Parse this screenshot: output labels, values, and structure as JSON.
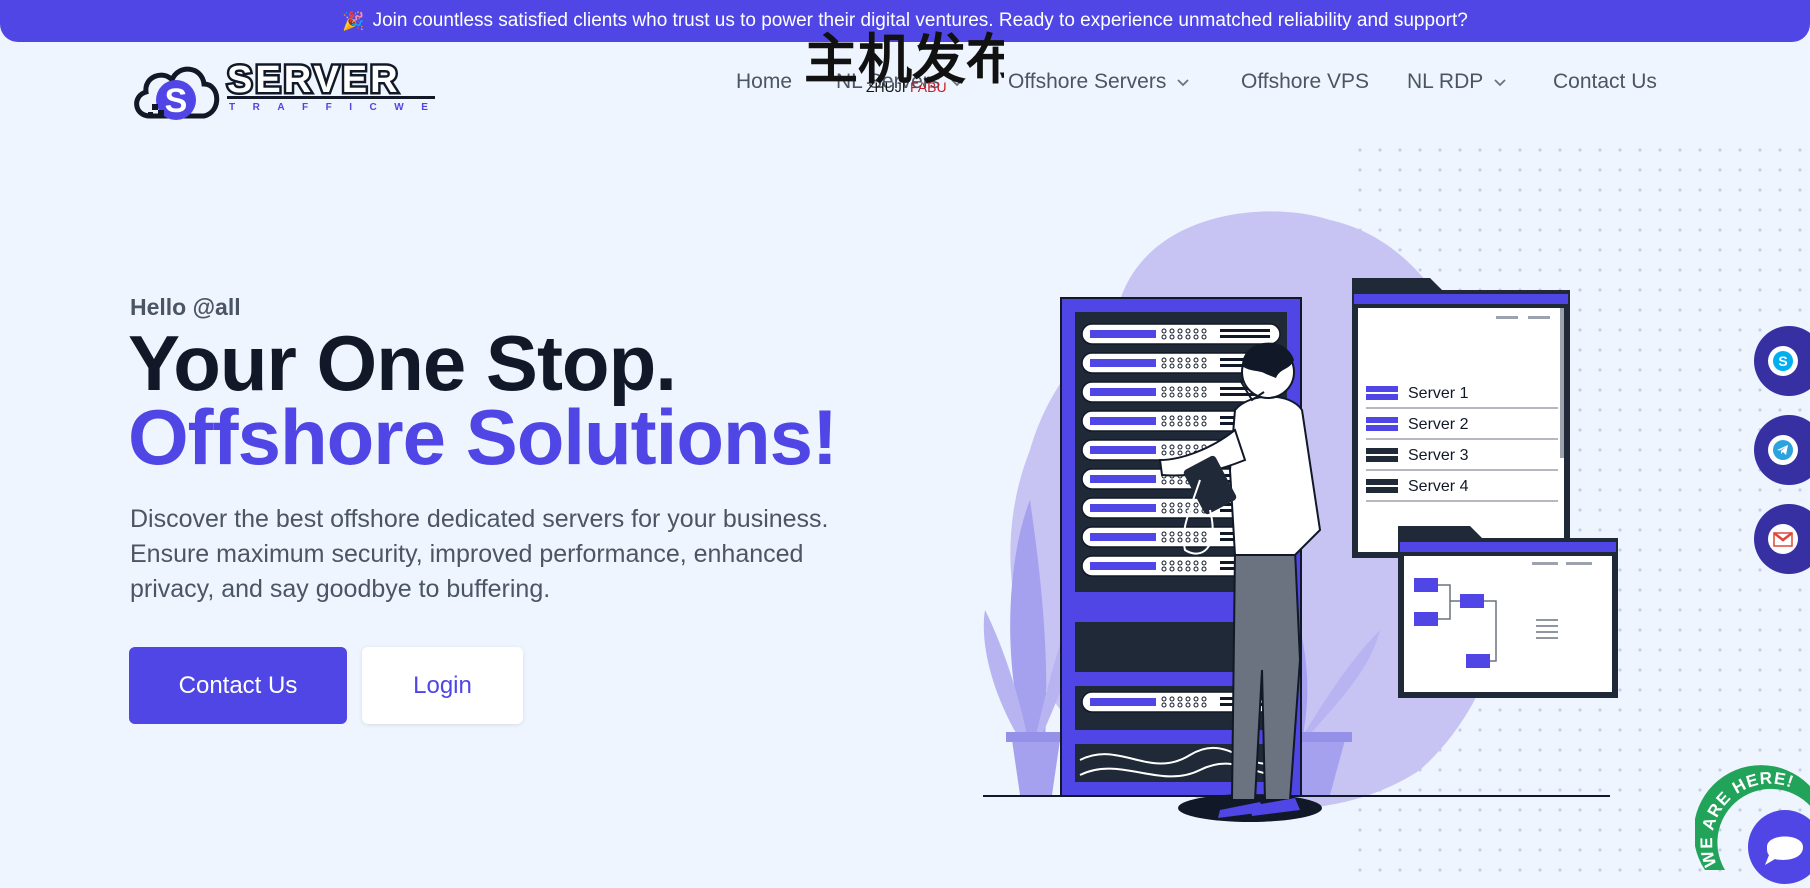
{
  "announcement": {
    "icon": "party-popper-icon",
    "text": "Join countless satisfied clients who trust us to power their digital ventures. Ready to experience unmatched reliability and support?"
  },
  "brand": {
    "name": "SERVER",
    "tagline": "TRAFFICWEB"
  },
  "watermark": {
    "cn": "主机发布",
    "latin_a": "ZHUJI",
    "latin_b": "FABU"
  },
  "nav": {
    "items": [
      {
        "label": "Home",
        "dropdown": false
      },
      {
        "label": "NL Servers",
        "dropdown": true
      },
      {
        "label": "Offshore Servers",
        "dropdown": true
      },
      {
        "label": "Offshore VPS",
        "dropdown": false
      },
      {
        "label": "NL RDP",
        "dropdown": true
      },
      {
        "label": "Contact Us",
        "dropdown": false
      }
    ]
  },
  "hero": {
    "greeting": "Hello @all",
    "headline_1": "Your One Stop.",
    "headline_2": "Offshore Solutions!",
    "description": "Discover the best offshore dedicated servers for your business. Ensure maximum security, improved performance, enhanced privacy, and say goodbye to buffering.",
    "cta_primary": "Contact Us",
    "cta_secondary": "Login"
  },
  "illustration": {
    "servers": [
      "Server 1",
      "Server 2",
      "Server 3",
      "Server 4"
    ]
  },
  "social": [
    {
      "icon": "skype-icon",
      "color": "#00aff0"
    },
    {
      "icon": "telegram-icon",
      "color": "#2aa3df"
    },
    {
      "icon": "gmail-icon",
      "color": "#e0463b"
    }
  ],
  "chat": {
    "badge_text": "WE ARE HERE!",
    "icon": "chat-bubble-icon"
  },
  "colors": {
    "accent": "#4f46e5",
    "background": "#eef5fe",
    "dark": "#111827",
    "chat_green": "#22a35a"
  }
}
